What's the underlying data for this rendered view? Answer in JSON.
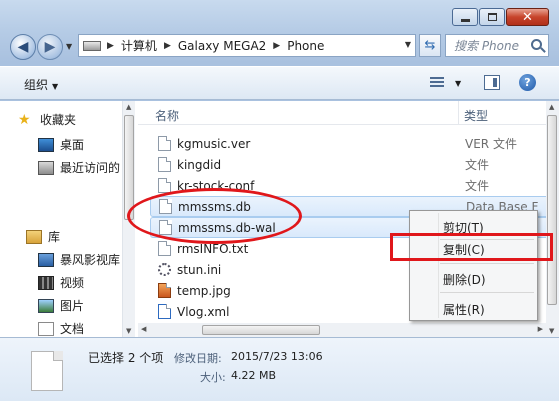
{
  "address": {
    "crumbs": [
      "计算机",
      "Galaxy MEGA2",
      "Phone"
    ]
  },
  "search": {
    "placeholder": "搜索 Phone"
  },
  "toolbar": {
    "organize_label": "组织"
  },
  "nav": {
    "favorites": "收藏夹",
    "desktop": "桌面",
    "recent": "最近访问的",
    "libraries": "库",
    "storm_video": "暴风影视库",
    "videos": "视频",
    "pictures": "图片",
    "documents": "文档"
  },
  "columns": {
    "name": "名称",
    "type": "类型"
  },
  "files": [
    {
      "name": "kgmusic.ver",
      "type": "VER 文件"
    },
    {
      "name": "kingdid",
      "type": "文件"
    },
    {
      "name": "kr-stock-conf",
      "type": "文件"
    },
    {
      "name": "mmssms.db",
      "type": "Data Base F"
    },
    {
      "name": "mmssms.db-wal",
      "type": ""
    },
    {
      "name": "rmsINFO.txt",
      "type": ""
    },
    {
      "name": "stun.ini",
      "type": ""
    },
    {
      "name": "temp.jpg",
      "type": ""
    },
    {
      "name": "Vlog.xml",
      "type": ""
    }
  ],
  "context_menu": {
    "cut": "剪切(T)",
    "copy": "复制(C)",
    "delete": "删除(D)",
    "properties": "属性(R)"
  },
  "details": {
    "selected": "已选择 2 个项",
    "modified_label": "修改日期:",
    "modified_value": "2015/7/23 13:06",
    "size_label": "大小:",
    "size_value": "4.22 MB"
  },
  "colors": {
    "annotation": "#e0171b",
    "selection": "#d9e9fb"
  }
}
